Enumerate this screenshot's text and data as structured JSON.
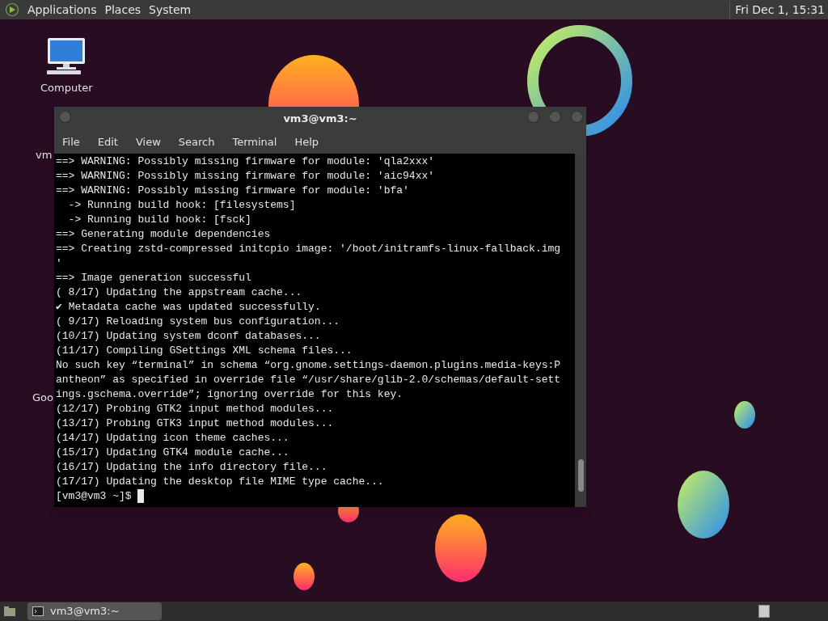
{
  "top_panel": {
    "menus": [
      "Applications",
      "Places",
      "System"
    ],
    "clock": "Fri Dec 1, 15:31"
  },
  "desktop_icons": [
    {
      "label": "Computer",
      "kind": "computer"
    },
    {
      "label": "vm",
      "kind": "partial"
    },
    {
      "label": "Goo",
      "kind": "partial"
    }
  ],
  "terminal": {
    "title": "vm3@vm3:~",
    "menu": [
      "File",
      "Edit",
      "View",
      "Search",
      "Terminal",
      "Help"
    ],
    "lines": [
      "==> WARNING: Possibly missing firmware for module: 'qla2xxx'",
      "==> WARNING: Possibly missing firmware for module: 'aic94xx'",
      "==> WARNING: Possibly missing firmware for module: 'bfa'",
      "  -> Running build hook: [filesystems]",
      "  -> Running build hook: [fsck]",
      "==> Generating module dependencies",
      "==> Creating zstd-compressed initcpio image: '/boot/initramfs-linux-fallback.img",
      "'",
      "==> Image generation successful",
      "( 8/17) Updating the appstream cache...",
      "✔ Metadata cache was updated successfully.",
      "( 9/17) Reloading system bus configuration...",
      "(10/17) Updating system dconf databases...",
      "(11/17) Compiling GSettings XML schema files...",
      "No such key “terminal” in schema “org.gnome.settings-daemon.plugins.media-keys:P",
      "antheon” as specified in override file “/usr/share/glib-2.0/schemas/default-sett",
      "ings.gschema.override”; ignoring override for this key.",
      "(12/17) Probing GTK2 input method modules...",
      "(13/17) Probing GTK3 input method modules...",
      "(14/17) Updating icon theme caches...",
      "(15/17) Updating GTK4 module cache...",
      "(16/17) Updating the info directory file...",
      "(17/17) Updating the desktop file MIME type cache..."
    ],
    "prompt": "[vm3@vm3 ~]$ "
  },
  "taskbar": {
    "tasks": [
      {
        "label": "vm3@vm3:~",
        "selected": true
      }
    ]
  }
}
